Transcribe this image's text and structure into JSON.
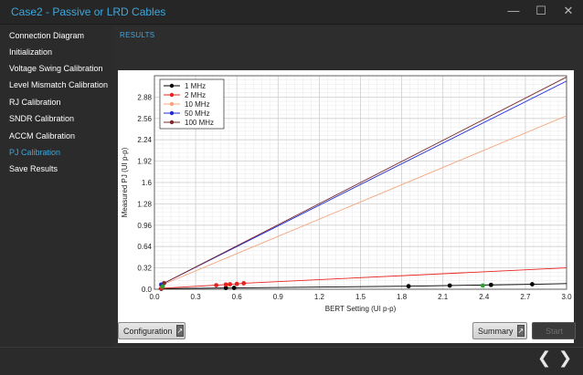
{
  "window": {
    "title": "Case2 - Passive or LRD Cables",
    "controls": [
      "—",
      "☐",
      "✕"
    ]
  },
  "sidebar": {
    "items": [
      {
        "label": "Connection Diagram",
        "active": false
      },
      {
        "label": "Initialization",
        "active": false
      },
      {
        "label": "Voltage Swing Calibration",
        "active": false
      },
      {
        "label": "Level Mismatch Calibration",
        "active": false
      },
      {
        "label": "RJ Calibration",
        "active": false
      },
      {
        "label": "SNDR Calibration",
        "active": false
      },
      {
        "label": "ACCM Calibration",
        "active": false
      },
      {
        "label": "PJ Calibration",
        "active": true
      },
      {
        "label": "Save Results",
        "active": false
      }
    ]
  },
  "main": {
    "section_label": "RESULTS",
    "buttons": {
      "configuration": "Configuration",
      "summary": "Summary",
      "start": "Start"
    }
  },
  "nav": {
    "back_icon": "chevron-left-icon",
    "forward_icon": "chevron-right-icon"
  },
  "colors": {
    "accent": "#3ea7dd",
    "series_1MHz": "#000000",
    "series_2MHz": "#e8231f",
    "series_10MHz": "#f4a57d",
    "series_50MHz": "#1f2bd6",
    "series_100MHz": "#7a2a2a"
  },
  "chart_data": {
    "type": "line",
    "title": "",
    "xlabel": "BERT Setting (UI p-p)",
    "ylabel": "Measured PJ (UI p-p)",
    "xlim": [
      0,
      3.0
    ],
    "ylim": [
      0,
      3.2
    ],
    "xticks": [
      "0.0",
      "0.3",
      "0.6",
      "0.9",
      "1.2",
      "1.5",
      "1.8",
      "2.1",
      "2.4",
      "2.7",
      "3.0"
    ],
    "yticks": [
      "0.0",
      "0.32",
      "0.64",
      "0.96",
      "1.28",
      "1.6",
      "1.92",
      "2.24",
      "2.56",
      "2.88"
    ],
    "grid": true,
    "legend_position": "top-left",
    "series": [
      {
        "name": "1 MHz",
        "color": "#000000",
        "x": [
          0.03,
          0.05,
          0.06,
          1.85,
          2.15,
          2.45,
          2.75,
          3.0
        ],
        "y": [
          0.005,
          0.008,
          0.01,
          0.045,
          0.055,
          0.065,
          0.075,
          0.085
        ],
        "markers_x": [
          0.05,
          0.52,
          0.58,
          1.85,
          2.15,
          2.45,
          2.75
        ]
      },
      {
        "name": "2 MHz",
        "color": "#e8231f",
        "x": [
          0.03,
          0.05,
          0.45,
          0.52,
          0.55,
          0.6,
          0.65,
          3.0
        ],
        "y": [
          0.01,
          0.015,
          0.06,
          0.07,
          0.075,
          0.08,
          0.09,
          0.32
        ],
        "markers_x": [
          0.05,
          0.45,
          0.52,
          0.55,
          0.6,
          0.65
        ]
      },
      {
        "name": "10 MHz",
        "color": "#f4a57d",
        "x": [
          0.05,
          3.0
        ],
        "y": [
          0.06,
          2.6
        ],
        "markers_x": [
          0.05
        ]
      },
      {
        "name": "50 MHz",
        "color": "#1f2bd6",
        "x": [
          0.05,
          3.0
        ],
        "y": [
          0.07,
          3.12
        ],
        "markers_x": [
          0.05
        ]
      },
      {
        "name": "100 MHz",
        "color": "#7a2a2a",
        "x": [
          0.05,
          3.0
        ],
        "y": [
          0.07,
          3.18
        ],
        "markers_x": [
          0.07
        ]
      }
    ],
    "extra_markers": [
      {
        "x": 0.06,
        "y": 0.04,
        "color": "#2e9e2e"
      },
      {
        "x": 2.39,
        "y": 0.055,
        "color": "#2e9e2e"
      }
    ]
  }
}
